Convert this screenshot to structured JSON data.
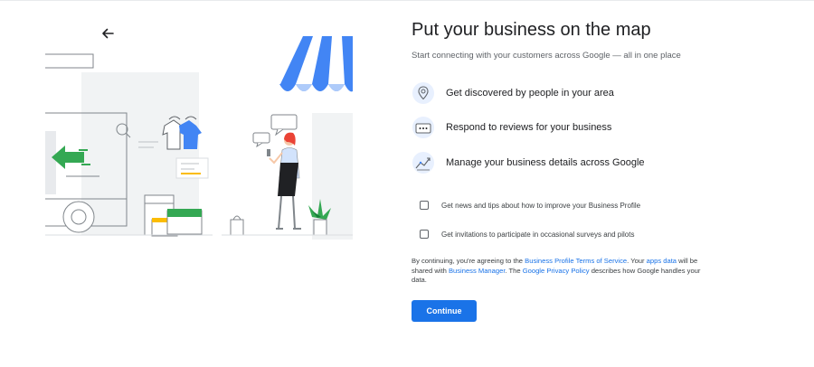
{
  "header": {
    "back_icon": "arrow-left-icon"
  },
  "title": "Put your business on the map",
  "subtitle": "Start connecting with your customers across Google — all in one place",
  "features": [
    {
      "icon": "map-pin-icon",
      "text": "Get discovered by people in your area"
    },
    {
      "icon": "chat-dots-icon",
      "text": "Respond to reviews for your business"
    },
    {
      "icon": "trend-chart-icon",
      "text": "Manage your business details across Google"
    }
  ],
  "checkboxes": [
    {
      "label": "Get news and tips about how to improve your Business Profile",
      "checked": false
    },
    {
      "label": "Get invitations to participate in occasional surveys and pilots",
      "checked": false
    }
  ],
  "legal": {
    "t1": "By continuing, you're agreeing to the ",
    "link1": "Business Profile Terms of Service",
    "t2": ". Your ",
    "link2": "apps data",
    "t3": " will be shared with ",
    "link3": "Business Manager",
    "t4": ". The ",
    "link4": "Google Privacy Policy",
    "t5": " describes how Google handles your data."
  },
  "continue_label": "Continue",
  "colors": {
    "accent": "#1a73e8",
    "green": "#34a853",
    "yellow": "#fbbc04",
    "red": "#ea4335",
    "icon_bg": "#e8f0fe"
  }
}
